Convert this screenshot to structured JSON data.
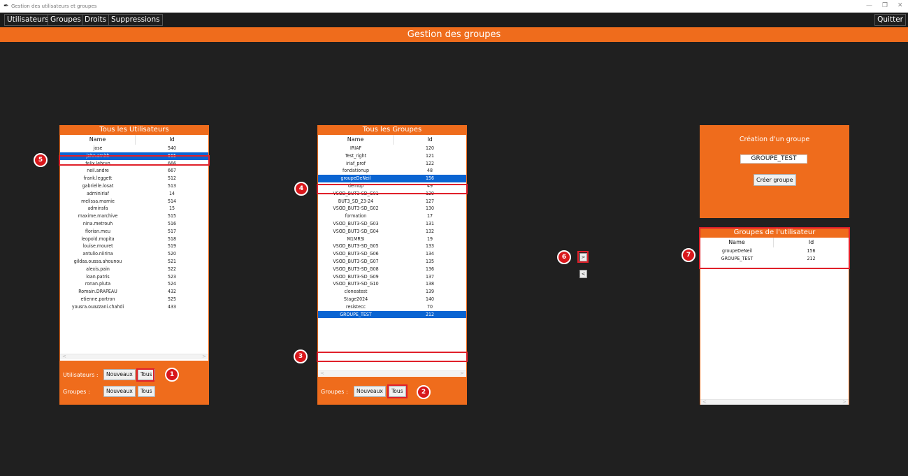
{
  "window": {
    "title": "Gestion des utilisateurs et groupes"
  },
  "menu": {
    "items": [
      "Utilisateurs",
      "Groupes",
      "Droits",
      "Suppressions"
    ],
    "quit": "Quitter"
  },
  "header": "Gestion des groupes",
  "users_panel": {
    "title": "Tous les Utilisateurs",
    "columns": [
      "Name",
      "Id"
    ],
    "rows": [
      [
        "jose",
        "540"
      ],
      [
        "john.smith",
        "665"
      ],
      [
        "felix.lebrun",
        "666"
      ],
      [
        "neil.andre",
        "667"
      ],
      [
        "frank.leggett",
        "512"
      ],
      [
        "gabrielle.losat",
        "513"
      ],
      [
        "adminiriaf",
        "14"
      ],
      [
        "melissa.mamie",
        "514"
      ],
      [
        "adminsfa",
        "15"
      ],
      [
        "maxime.marchive",
        "515"
      ],
      [
        "nina.metrouh",
        "516"
      ],
      [
        "florian.meu",
        "517"
      ],
      [
        "leopold.mopita",
        "518"
      ],
      [
        "louise.mouret",
        "519"
      ],
      [
        "antulio.niirina",
        "520"
      ],
      [
        "gildas.oussa.ahounou",
        "521"
      ],
      [
        "alexis.pain",
        "522"
      ],
      [
        "loan.patris",
        "523"
      ],
      [
        "ronan.pluta",
        "524"
      ],
      [
        "Romain.DRAPEAU",
        "432"
      ],
      [
        "etienne.portron",
        "525"
      ],
      [
        "yousra.ouazzani.chahdi",
        "433"
      ]
    ],
    "selected_index": 1,
    "utilisateurs_label": "Utilisateurs :",
    "groupes_label": "Groupes :",
    "btn_nouveaux": "Nouveaux",
    "btn_tous": "Tous"
  },
  "groups_panel": {
    "title": "Tous les Groupes",
    "columns": [
      "Name",
      "Id"
    ],
    "rows": [
      [
        "IRIAF",
        "120"
      ],
      [
        "Test_right",
        "121"
      ],
      [
        "iriaf_prof",
        "122"
      ],
      [
        "fondationup",
        "48"
      ],
      [
        "groupeDeNeil",
        "156"
      ],
      [
        "demup",
        "49"
      ],
      [
        "VSOD_BUT3-SD_G01",
        "129"
      ],
      [
        "BUT3_SD_23-24",
        "127"
      ],
      [
        "VSOD_BUT3-SD_G02",
        "130"
      ],
      [
        "formation",
        "17"
      ],
      [
        "VSOD_BUT3-SD_G03",
        "131"
      ],
      [
        "VSOD_BUT3-SD_G04",
        "132"
      ],
      [
        "M1MRSI",
        "19"
      ],
      [
        "VSOD_BUT3-SD_G05",
        "133"
      ],
      [
        "VSOD_BUT3-SD_G06",
        "134"
      ],
      [
        "VSOD_BUT3-SD_G07",
        "135"
      ],
      [
        "VSOD_BUT3-SD_G08",
        "136"
      ],
      [
        "VSOD_BUT3-SD_G09",
        "137"
      ],
      [
        "VSOD_BUT3-SD_G10",
        "138"
      ],
      [
        "cloneatest",
        "139"
      ],
      [
        "Stage2024",
        "140"
      ],
      [
        "resistecc",
        "70"
      ],
      [
        "GROUPE_TEST",
        "212"
      ]
    ],
    "selected_indices": [
      4,
      22
    ],
    "groupes_label": "Groupes :",
    "btn_nouveaux": "Nouveaux",
    "btn_tous": "Tous"
  },
  "transfer": {
    "add": ">",
    "remove": "<"
  },
  "create_panel": {
    "title": "Création d'un groupe",
    "input_value": "GROUPE_TEST",
    "button": "Créer groupe"
  },
  "user_groups_panel": {
    "title": "Groupes de l'utilisateur",
    "columns": [
      "Name",
      "Id"
    ],
    "rows": [
      [
        "groupeDeNeil",
        "156"
      ],
      [
        "GROUPE_TEST",
        "212"
      ]
    ]
  },
  "badges": [
    "1",
    "2",
    "3",
    "4",
    "5",
    "6",
    "7"
  ],
  "colors": {
    "accent": "#ef6c1c",
    "selection": "#0a64d2",
    "highlight": "#e0202a",
    "background": "#202020"
  }
}
